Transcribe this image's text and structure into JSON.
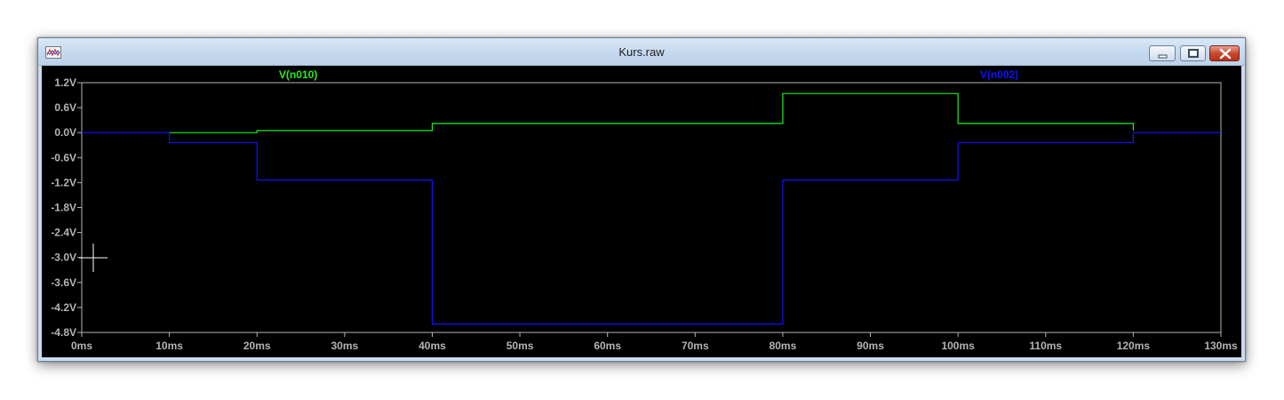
{
  "window": {
    "title": "Kurs.raw",
    "icon": "waveform-icon",
    "buttons": {
      "minimize": "minimize-icon",
      "maximize": "maximize-icon",
      "close": "close-icon"
    }
  },
  "colors": {
    "background": "#000000",
    "axis": "#b4b4b4",
    "trace_green": "#22ee22",
    "trace_blue": "#1010ff",
    "cursor": "#ffffff"
  },
  "chart_data": {
    "type": "line",
    "title": "",
    "xlabel": "",
    "ylabel": "",
    "x_unit": "ms",
    "y_unit": "V",
    "xlim": [
      0,
      130
    ],
    "ylim": [
      -4.8,
      1.2
    ],
    "grid": false,
    "x_ticks": [
      "0ms",
      "10ms",
      "20ms",
      "30ms",
      "40ms",
      "50ms",
      "60ms",
      "70ms",
      "80ms",
      "90ms",
      "100ms",
      "110ms",
      "120ms",
      "130ms"
    ],
    "y_ticks": [
      "1.2V",
      "0.6V",
      "0.0V",
      "-0.6V",
      "-1.2V",
      "-1.8V",
      "-2.4V",
      "-3.0V",
      "-3.6V",
      "-4.2V",
      "-4.8V"
    ],
    "series": [
      {
        "name": "V(n010)",
        "color": "#22ee22",
        "step": true,
        "x": [
          10,
          20,
          40,
          80,
          100,
          120
        ],
        "y": [
          0.0,
          0.05,
          0.22,
          0.94,
          0.22,
          0.05
        ]
      },
      {
        "name": "V(n002)",
        "color": "#1010ff",
        "step": true,
        "x": [
          0,
          10,
          20,
          40,
          80,
          100,
          120,
          130
        ],
        "y": [
          0.0,
          -0.24,
          -1.14,
          -4.6,
          -1.14,
          -0.24,
          0.0,
          0.0
        ]
      }
    ]
  }
}
